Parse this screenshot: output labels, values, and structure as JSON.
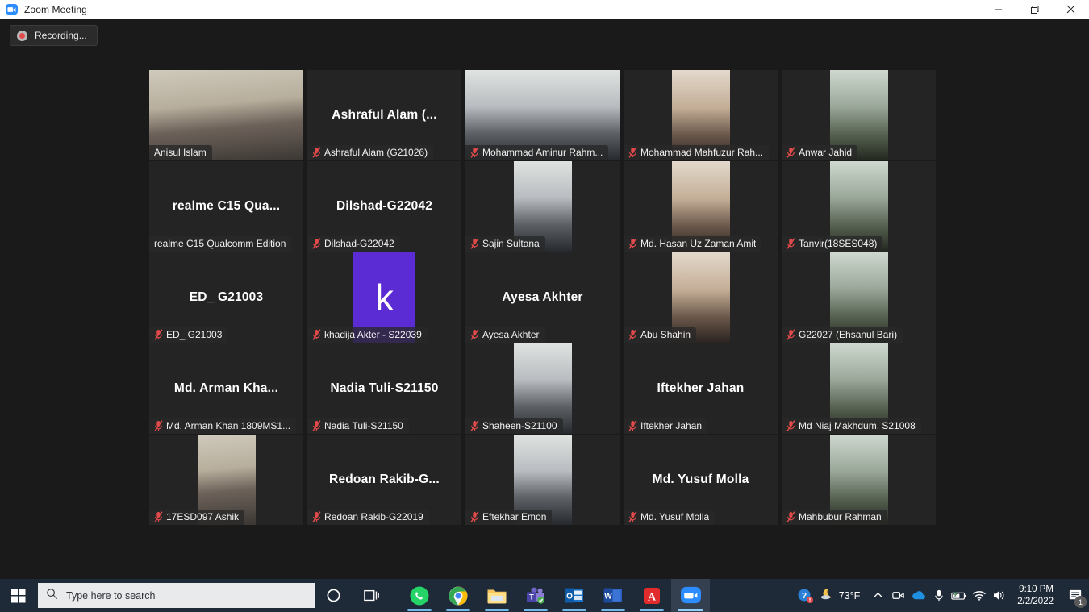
{
  "window": {
    "title": "Zoom Meeting",
    "app_icon": "zoom-icon",
    "minimize_label": "─",
    "restore_label": "❐",
    "close_label": "✕"
  },
  "recording": {
    "label": "Recording...",
    "icon": "record-dot-icon"
  },
  "colors": {
    "active_speaker_border": "#d4e157",
    "tile_bg": "#242424",
    "stage_bg": "#1a1a1a",
    "mute_icon": "#e04a4a",
    "avatar_purple": "#5b2bd4",
    "taskbar_bg": "#1f2a38"
  },
  "gallery": {
    "tiles": [
      {
        "display_name": "Anisul Islam",
        "label": "Anisul Islam",
        "muted": false,
        "active_speaker": true,
        "media": "video",
        "media_kind": "wide",
        "show_bigname": false
      },
      {
        "display_name": "Ashraful Alam (...",
        "label": "Ashraful Alam (G21026)",
        "muted": true,
        "active_speaker": false,
        "media": "none",
        "show_bigname": true
      },
      {
        "display_name": "Mohammad Aminur Rahm...",
        "label": "Mohammad Aminur Rahm...",
        "muted": true,
        "active_speaker": false,
        "media": "video",
        "media_kind": "wide",
        "show_bigname": false
      },
      {
        "display_name": "Mohammad Mahfuzur Rah...",
        "label": "Mohammad Mahfuzur Rah...",
        "muted": true,
        "active_speaker": false,
        "media": "photo",
        "media_kind": "portrait",
        "show_bigname": false
      },
      {
        "display_name": "Anwar Jahid",
        "label": "Anwar Jahid",
        "muted": true,
        "active_speaker": false,
        "media": "photo",
        "media_kind": "portrait",
        "show_bigname": false
      },
      {
        "display_name": "realme C15 Qua...",
        "label": "realme C15 Qualcomm Edition",
        "muted": false,
        "active_speaker": false,
        "media": "none",
        "show_bigname": true
      },
      {
        "display_name": "Dilshad-G22042",
        "label": "Dilshad-G22042",
        "muted": true,
        "active_speaker": false,
        "media": "none",
        "show_bigname": true
      },
      {
        "display_name": "Sajin Sultana",
        "label": "Sajin Sultana",
        "muted": true,
        "active_speaker": false,
        "media": "photo",
        "media_kind": "portrait",
        "show_bigname": false
      },
      {
        "display_name": "Md. Hasan Uz Zaman Amit",
        "label": "Md. Hasan Uz Zaman Amit",
        "muted": true,
        "active_speaker": false,
        "media": "photo",
        "media_kind": "portrait",
        "show_bigname": false
      },
      {
        "display_name": "Tanvir(18SES048)",
        "label": "Tanvir(18SES048)",
        "muted": true,
        "active_speaker": false,
        "media": "photo",
        "media_kind": "portrait",
        "show_bigname": false
      },
      {
        "display_name": "ED_ G21003",
        "label": "ED_ G21003",
        "muted": true,
        "active_speaker": false,
        "media": "none",
        "show_bigname": true
      },
      {
        "display_name": "khadija Akter - S22039",
        "label": "khadija Akter - S22039",
        "muted": true,
        "active_speaker": false,
        "media": "initial",
        "initial": "k",
        "show_bigname": false
      },
      {
        "display_name": "Ayesa Akhter",
        "label": "Ayesa Akhter",
        "muted": true,
        "active_speaker": false,
        "media": "none",
        "show_bigname": true
      },
      {
        "display_name": "Abu Shahin",
        "label": "Abu Shahin",
        "muted": true,
        "active_speaker": false,
        "media": "photo",
        "media_kind": "portrait",
        "show_bigname": false
      },
      {
        "display_name": "G22027 (Ehsanul Bari)",
        "label": "G22027 (Ehsanul Bari)",
        "muted": true,
        "active_speaker": false,
        "media": "photo",
        "media_kind": "portrait",
        "show_bigname": false
      },
      {
        "display_name": "Md. Arman Kha...",
        "label": "Md. Arman Khan 1809MS1...",
        "muted": true,
        "active_speaker": false,
        "media": "none",
        "show_bigname": true
      },
      {
        "display_name": "Nadia Tuli-S21150",
        "label": "Nadia Tuli-S21150",
        "muted": true,
        "active_speaker": false,
        "media": "none",
        "show_bigname": true
      },
      {
        "display_name": "Shaheen-S21100",
        "label": "Shaheen-S21100",
        "muted": true,
        "active_speaker": false,
        "media": "photo",
        "media_kind": "portrait",
        "show_bigname": false
      },
      {
        "display_name": "Iftekher Jahan",
        "label": "Iftekher Jahan",
        "muted": true,
        "active_speaker": false,
        "media": "none",
        "show_bigname": true
      },
      {
        "display_name": "Md Niaj Makhdum, S21008",
        "label": "Md Niaj Makhdum, S21008",
        "muted": true,
        "active_speaker": false,
        "media": "photo",
        "media_kind": "portrait",
        "show_bigname": false
      },
      {
        "display_name": "17ESD097 Ashik",
        "label": "17ESD097 Ashik",
        "muted": true,
        "active_speaker": false,
        "media": "photo",
        "media_kind": "portrait",
        "show_bigname": false
      },
      {
        "display_name": "Redoan  Rakib-G...",
        "label": "Redoan Rakib-G22019",
        "muted": true,
        "active_speaker": false,
        "media": "none",
        "show_bigname": true
      },
      {
        "display_name": "Eftekhar Emon",
        "label": "Eftekhar Emon",
        "muted": true,
        "active_speaker": false,
        "media": "photo",
        "media_kind": "portrait",
        "show_bigname": false
      },
      {
        "display_name": "Md. Yusuf Molla",
        "label": "Md. Yusuf Molla",
        "muted": true,
        "active_speaker": false,
        "media": "none",
        "show_bigname": true
      },
      {
        "display_name": "Mahbubur Rahman",
        "label": "Mahbubur Rahman",
        "muted": true,
        "active_speaker": false,
        "media": "photo",
        "media_kind": "portrait",
        "show_bigname": false
      }
    ]
  },
  "taskbar": {
    "start_icon": "windows-start-icon",
    "search": {
      "placeholder": "Type here to search",
      "icon": "search-icon"
    },
    "cortana_icon": "cortana-circle-icon",
    "taskview_icon": "task-view-icon",
    "apps": [
      {
        "name": "whatsapp-icon",
        "running": true,
        "active": false
      },
      {
        "name": "google-chrome-icon",
        "running": true,
        "active": false
      },
      {
        "name": "file-explorer-icon",
        "running": true,
        "active": false
      },
      {
        "name": "microsoft-teams-icon",
        "running": true,
        "active": false
      },
      {
        "name": "outlook-icon",
        "running": true,
        "active": false
      },
      {
        "name": "microsoft-word-icon",
        "running": true,
        "active": false
      },
      {
        "name": "adobe-acrobat-icon",
        "running": true,
        "active": false
      },
      {
        "name": "zoom-icon",
        "running": true,
        "active": true
      }
    ],
    "tray": {
      "help_icon": "help-question-icon",
      "weather_icon": "moon-weather-icon",
      "temperature": "73°F",
      "chevron_icon": "show-hidden-icons-chevron",
      "meet_now_icon": "meet-now-icon",
      "onedrive_icon": "onedrive-cloud-icon",
      "mic_icon": "microphone-icon",
      "battery_icon": "battery-charging-icon",
      "network_icon": "wifi-icon",
      "volume_icon": "speaker-volume-icon",
      "time": "9:10 PM",
      "date": "2/2/2022",
      "notification_icon": "action-center-icon",
      "notification_count": "1"
    }
  }
}
